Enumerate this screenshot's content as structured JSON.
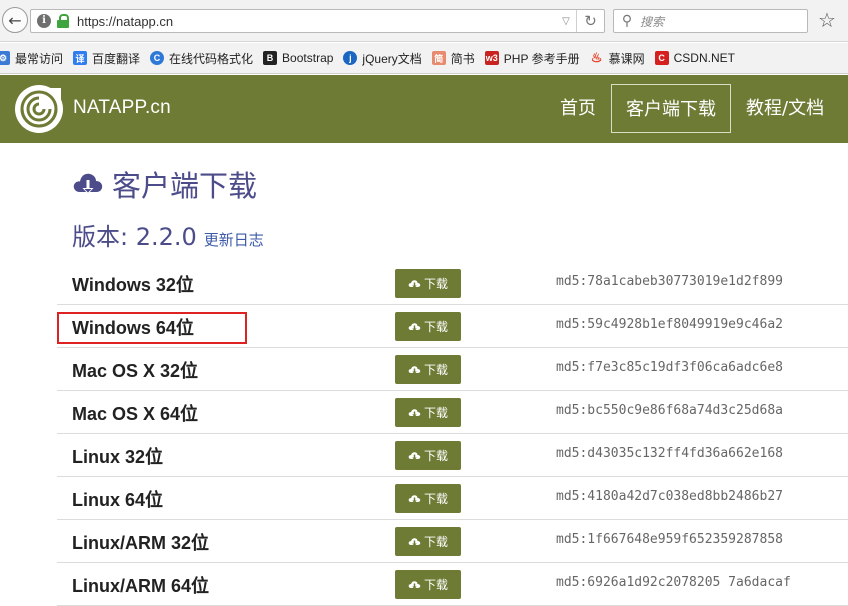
{
  "browser": {
    "url": "https://natapp.cn",
    "search_placeholder": "搜索",
    "bookmarks": [
      {
        "label": "最常访问",
        "icon": "gear-icon",
        "color": "#3b7bd6"
      },
      {
        "label": "百度翻译",
        "icon": "translate-icon",
        "color": "#2f7ef0"
      },
      {
        "label": "在线代码格式化",
        "icon": "code-icon",
        "color": "#2e79d8"
      },
      {
        "label": "Bootstrap",
        "icon": "bootstrap-icon",
        "color": "#222222"
      },
      {
        "label": "jQuery文档",
        "icon": "jquery-icon",
        "color": "#1a66c2"
      },
      {
        "label": "简书",
        "icon": "jianshu-icon",
        "color": "#e88a6e"
      },
      {
        "label": "PHP 参考手册",
        "icon": "php-icon",
        "color": "#c8231e"
      },
      {
        "label": "慕课网",
        "icon": "flame-icon",
        "color": "#e53b1e"
      },
      {
        "label": "CSDN.NET",
        "icon": "csdn-icon",
        "color": "#d61f1f"
      }
    ]
  },
  "site": {
    "brand": "NATAPP.cn",
    "nav": {
      "home": "首页",
      "client": "客户端下载",
      "docs": "教程/文档"
    },
    "accent": "#6e7b35"
  },
  "main": {
    "title": "客户端下载",
    "version_label": "版本: 2.2.0",
    "changelog": "更新日志",
    "download_label": "下载",
    "downloads": [
      {
        "platform": "Windows 32位",
        "md5": "md5:78a1cabeb30773019e1d2f899"
      },
      {
        "platform": "Windows 64位",
        "md5": "md5:59c4928b1ef8049919e9c46a2"
      },
      {
        "platform": "Mac OS X 32位",
        "md5": "md5:f7e3c85c19df3f06ca6adc6e8"
      },
      {
        "platform": "Mac OS X 64位",
        "md5": "md5:bc550c9e86f68a74d3c25d68a"
      },
      {
        "platform": "Linux 32位",
        "md5": "md5:d43035c132ff4fd36a662e168"
      },
      {
        "platform": "Linux 64位",
        "md5": "md5:4180a42d7c038ed8bb2486b27"
      },
      {
        "platform": "Linux/ARM 32位",
        "md5": "md5:1f667648e959f652359287858"
      },
      {
        "platform": "Linux/ARM 64位",
        "md5": "md5:6926a1d92c2078205 7a6dacaf"
      }
    ]
  }
}
